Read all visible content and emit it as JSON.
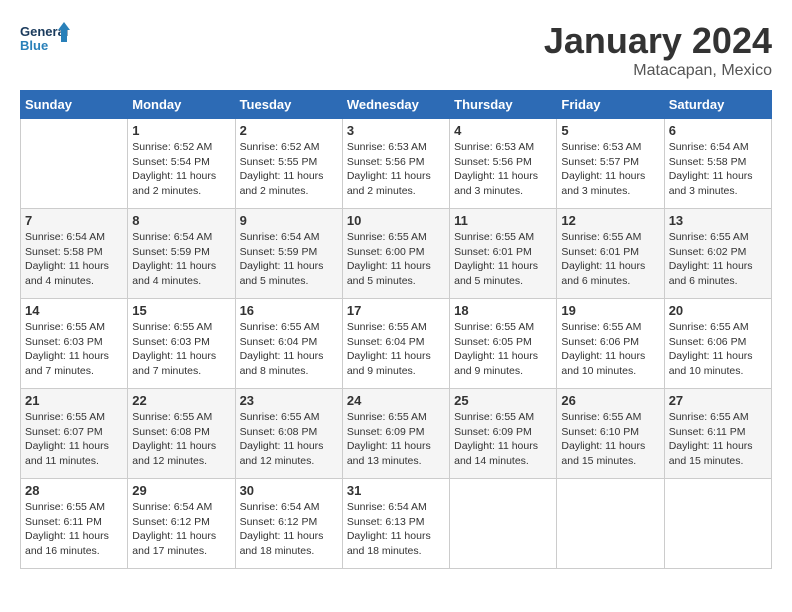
{
  "logo": {
    "line1": "General",
    "line2": "Blue"
  },
  "title": "January 2024",
  "location": "Matacapan, Mexico",
  "days_of_week": [
    "Sunday",
    "Monday",
    "Tuesday",
    "Wednesday",
    "Thursday",
    "Friday",
    "Saturday"
  ],
  "weeks": [
    [
      {
        "day": "",
        "info": ""
      },
      {
        "day": "1",
        "info": "Sunrise: 6:52 AM\nSunset: 5:54 PM\nDaylight: 11 hours\nand 2 minutes."
      },
      {
        "day": "2",
        "info": "Sunrise: 6:52 AM\nSunset: 5:55 PM\nDaylight: 11 hours\nand 2 minutes."
      },
      {
        "day": "3",
        "info": "Sunrise: 6:53 AM\nSunset: 5:56 PM\nDaylight: 11 hours\nand 2 minutes."
      },
      {
        "day": "4",
        "info": "Sunrise: 6:53 AM\nSunset: 5:56 PM\nDaylight: 11 hours\nand 3 minutes."
      },
      {
        "day": "5",
        "info": "Sunrise: 6:53 AM\nSunset: 5:57 PM\nDaylight: 11 hours\nand 3 minutes."
      },
      {
        "day": "6",
        "info": "Sunrise: 6:54 AM\nSunset: 5:58 PM\nDaylight: 11 hours\nand 3 minutes."
      }
    ],
    [
      {
        "day": "7",
        "info": "Sunrise: 6:54 AM\nSunset: 5:58 PM\nDaylight: 11 hours\nand 4 minutes."
      },
      {
        "day": "8",
        "info": "Sunrise: 6:54 AM\nSunset: 5:59 PM\nDaylight: 11 hours\nand 4 minutes."
      },
      {
        "day": "9",
        "info": "Sunrise: 6:54 AM\nSunset: 5:59 PM\nDaylight: 11 hours\nand 5 minutes."
      },
      {
        "day": "10",
        "info": "Sunrise: 6:55 AM\nSunset: 6:00 PM\nDaylight: 11 hours\nand 5 minutes."
      },
      {
        "day": "11",
        "info": "Sunrise: 6:55 AM\nSunset: 6:01 PM\nDaylight: 11 hours\nand 5 minutes."
      },
      {
        "day": "12",
        "info": "Sunrise: 6:55 AM\nSunset: 6:01 PM\nDaylight: 11 hours\nand 6 minutes."
      },
      {
        "day": "13",
        "info": "Sunrise: 6:55 AM\nSunset: 6:02 PM\nDaylight: 11 hours\nand 6 minutes."
      }
    ],
    [
      {
        "day": "14",
        "info": "Sunrise: 6:55 AM\nSunset: 6:03 PM\nDaylight: 11 hours\nand 7 minutes."
      },
      {
        "day": "15",
        "info": "Sunrise: 6:55 AM\nSunset: 6:03 PM\nDaylight: 11 hours\nand 7 minutes."
      },
      {
        "day": "16",
        "info": "Sunrise: 6:55 AM\nSunset: 6:04 PM\nDaylight: 11 hours\nand 8 minutes."
      },
      {
        "day": "17",
        "info": "Sunrise: 6:55 AM\nSunset: 6:04 PM\nDaylight: 11 hours\nand 9 minutes."
      },
      {
        "day": "18",
        "info": "Sunrise: 6:55 AM\nSunset: 6:05 PM\nDaylight: 11 hours\nand 9 minutes."
      },
      {
        "day": "19",
        "info": "Sunrise: 6:55 AM\nSunset: 6:06 PM\nDaylight: 11 hours\nand 10 minutes."
      },
      {
        "day": "20",
        "info": "Sunrise: 6:55 AM\nSunset: 6:06 PM\nDaylight: 11 hours\nand 10 minutes."
      }
    ],
    [
      {
        "day": "21",
        "info": "Sunrise: 6:55 AM\nSunset: 6:07 PM\nDaylight: 11 hours\nand 11 minutes."
      },
      {
        "day": "22",
        "info": "Sunrise: 6:55 AM\nSunset: 6:08 PM\nDaylight: 11 hours\nand 12 minutes."
      },
      {
        "day": "23",
        "info": "Sunrise: 6:55 AM\nSunset: 6:08 PM\nDaylight: 11 hours\nand 12 minutes."
      },
      {
        "day": "24",
        "info": "Sunrise: 6:55 AM\nSunset: 6:09 PM\nDaylight: 11 hours\nand 13 minutes."
      },
      {
        "day": "25",
        "info": "Sunrise: 6:55 AM\nSunset: 6:09 PM\nDaylight: 11 hours\nand 14 minutes."
      },
      {
        "day": "26",
        "info": "Sunrise: 6:55 AM\nSunset: 6:10 PM\nDaylight: 11 hours\nand 15 minutes."
      },
      {
        "day": "27",
        "info": "Sunrise: 6:55 AM\nSunset: 6:11 PM\nDaylight: 11 hours\nand 15 minutes."
      }
    ],
    [
      {
        "day": "28",
        "info": "Sunrise: 6:55 AM\nSunset: 6:11 PM\nDaylight: 11 hours\nand 16 minutes."
      },
      {
        "day": "29",
        "info": "Sunrise: 6:54 AM\nSunset: 6:12 PM\nDaylight: 11 hours\nand 17 minutes."
      },
      {
        "day": "30",
        "info": "Sunrise: 6:54 AM\nSunset: 6:12 PM\nDaylight: 11 hours\nand 18 minutes."
      },
      {
        "day": "31",
        "info": "Sunrise: 6:54 AM\nSunset: 6:13 PM\nDaylight: 11 hours\nand 18 minutes."
      },
      {
        "day": "",
        "info": ""
      },
      {
        "day": "",
        "info": ""
      },
      {
        "day": "",
        "info": ""
      }
    ]
  ]
}
